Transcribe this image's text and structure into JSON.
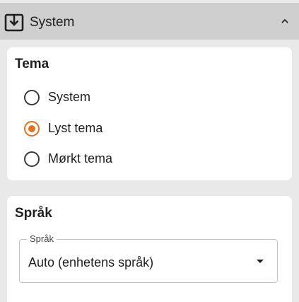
{
  "header": {
    "title": "System",
    "icon": "download-box-icon",
    "chevron": "chevron-up-icon"
  },
  "theme_card": {
    "title": "Tema",
    "options": [
      {
        "label": "System",
        "checked": false
      },
      {
        "label": "Lyst tema",
        "checked": true
      },
      {
        "label": "Mørkt tema",
        "checked": false
      }
    ]
  },
  "language_card": {
    "title": "Språk",
    "select": {
      "legend": "Språk",
      "value": "Auto (enhetens språk)",
      "icon": "dropdown-arrow-icon"
    }
  },
  "colors": {
    "accent": "#e8711c",
    "header_bg": "#cfcfcf",
    "page_bg": "#e9e9e9",
    "card_bg": "#ffffff"
  }
}
